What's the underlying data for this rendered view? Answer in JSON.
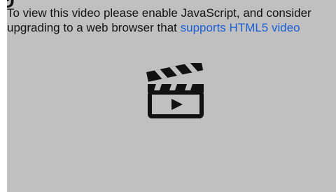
{
  "fallback": {
    "top_glyph": "g",
    "message_prefix": "To view this video please enable JavaScript, and consider upgrading to a web browser that ",
    "link_text": "supports HTML5 video"
  },
  "icons": {
    "video_placeholder": "clapperboard-play-icon"
  },
  "colors": {
    "player_background": "#c0c0c0",
    "link": "#1a5fd6",
    "text": "#111111"
  }
}
